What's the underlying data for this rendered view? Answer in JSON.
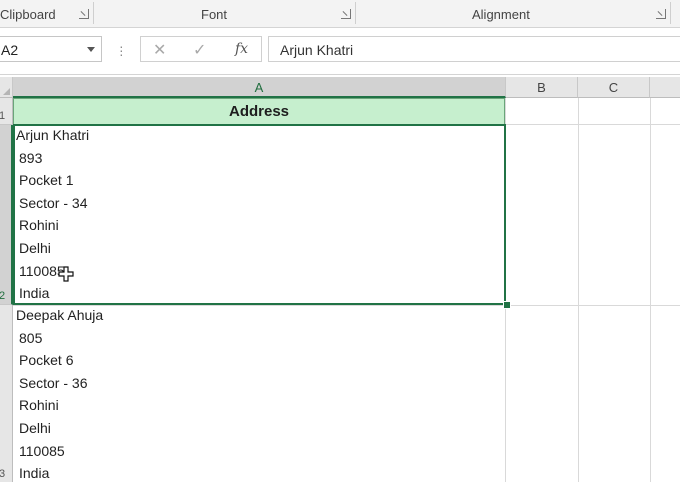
{
  "ribbon": {
    "groups": [
      {
        "label": "Clipboard"
      },
      {
        "label": "Font"
      },
      {
        "label": "Alignment"
      }
    ]
  },
  "formula_bar": {
    "name_box": "A2",
    "cancel_icon": "✕",
    "enter_icon": "✓",
    "fx_label": "fx",
    "formula_value": "Arjun Khatri"
  },
  "grid": {
    "columns": [
      "A",
      "B",
      "C"
    ],
    "rows": [
      "1",
      "2",
      "3"
    ],
    "selected_cell": "A2",
    "header_cell": "Address",
    "header_fill": "#c6efce",
    "accent": "#217346",
    "row2_lines": [
      "Arjun Khatri",
      "893",
      "Pocket 1",
      "Sector - 34",
      "Rohini",
      "Delhi",
      "110085",
      "India"
    ],
    "row3_lines": [
      "Deepak Ahuja",
      "805",
      "Pocket 6",
      "Sector - 36",
      "Rohini",
      "Delhi",
      "110085",
      "India"
    ]
  }
}
